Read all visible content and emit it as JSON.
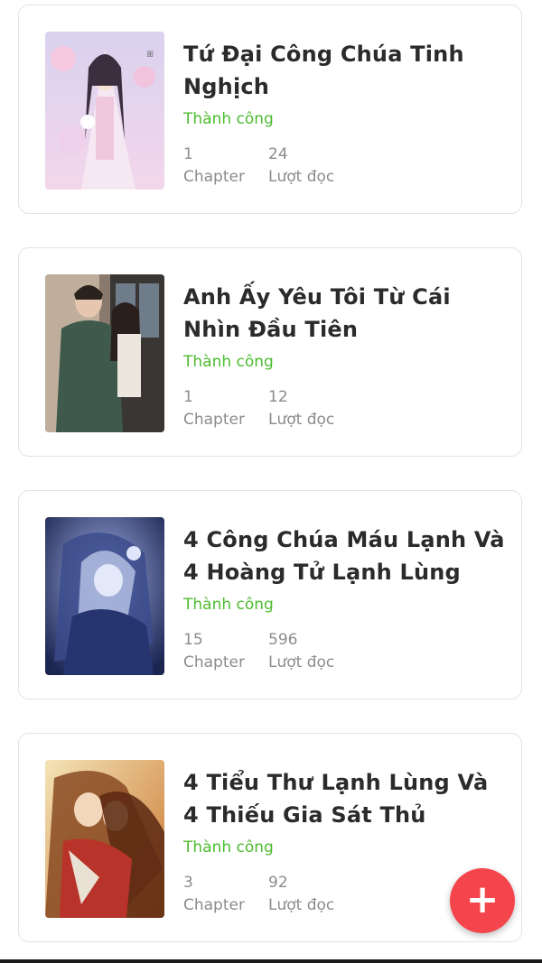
{
  "stories": [
    {
      "title": "Tứ Đại Công Chúa Tinh Nghịch",
      "status": "Thành công",
      "chapters": "1",
      "chapters_label": "Chapter",
      "views": "24",
      "views_label": "Lượt đọc"
    },
    {
      "title": "Anh Ấy Yêu Tôi Từ Cái Nhìn Đầu Tiên",
      "status": "Thành công",
      "chapters": "1",
      "chapters_label": "Chapter",
      "views": "12",
      "views_label": "Lượt đọc"
    },
    {
      "title": "4 Công Chúa Máu Lạnh Và 4 Hoàng Tử Lạnh Lùng",
      "status": "Thành công",
      "chapters": "15",
      "chapters_label": "Chapter",
      "views": "596",
      "views_label": "Lượt đọc"
    },
    {
      "title": "4 Tiểu Thư Lạnh Lùng Và 4 Thiếu Gia Sát Thủ",
      "status": "Thành công",
      "chapters": "3",
      "chapters_label": "Chapter",
      "views": "92",
      "views_label": "Lượt đọc"
    }
  ],
  "fab": {
    "icon": "plus-icon",
    "label": "+"
  },
  "colors": {
    "status": "#4cbb2f",
    "fab": "#f4454d",
    "title": "#2b2b2b",
    "meta": "#8c8c8c"
  }
}
